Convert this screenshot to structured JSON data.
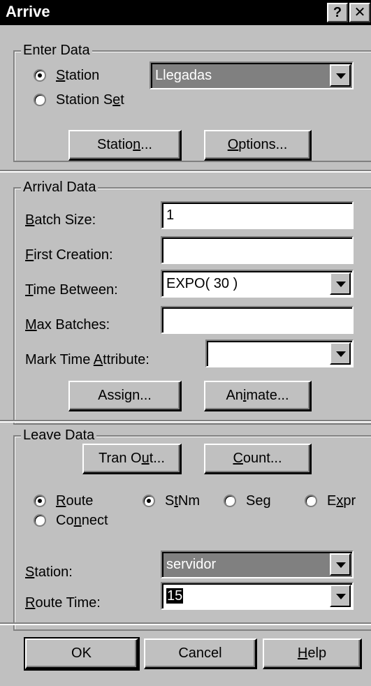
{
  "window": {
    "title": "Arrive",
    "help_glyph": "?",
    "close_glyph": "✕"
  },
  "enter_data": {
    "legend": "Enter Data",
    "radio_station": "Station",
    "radio_station_set": "Station Set",
    "selected_radio": "Station",
    "station_value": "Llegadas",
    "station_button": "Station...",
    "options_button": "Options..."
  },
  "arrival_data": {
    "legend": "Arrival Data",
    "batch_size_label": "Batch Size:",
    "batch_size_value": "1",
    "first_creation_label": "First Creation:",
    "first_creation_value": "",
    "time_between_label": "Time Between:",
    "time_between_value": "EXPO( 30 )",
    "max_batches_label": "Max Batches:",
    "max_batches_value": "",
    "mark_time_label": "Mark Time Attribute:",
    "mark_time_value": "",
    "assign_button": "Assign...",
    "animate_button": "Animate..."
  },
  "leave_data": {
    "legend": "Leave Data",
    "tran_out_button": "Tran Out...",
    "count_button": "Count...",
    "radio_route": "Route",
    "radio_connect": "Connect",
    "selected_mode": "Route",
    "radio_stnm": "StNm",
    "radio_seg": "Seg",
    "radio_expr": "Expr",
    "selected_dest": "StNm",
    "station_label": "Station:",
    "station_value": "servidor",
    "route_time_label": "Route Time:",
    "route_time_value": "15"
  },
  "footer": {
    "ok": "OK",
    "cancel": "Cancel",
    "help": "Help"
  }
}
